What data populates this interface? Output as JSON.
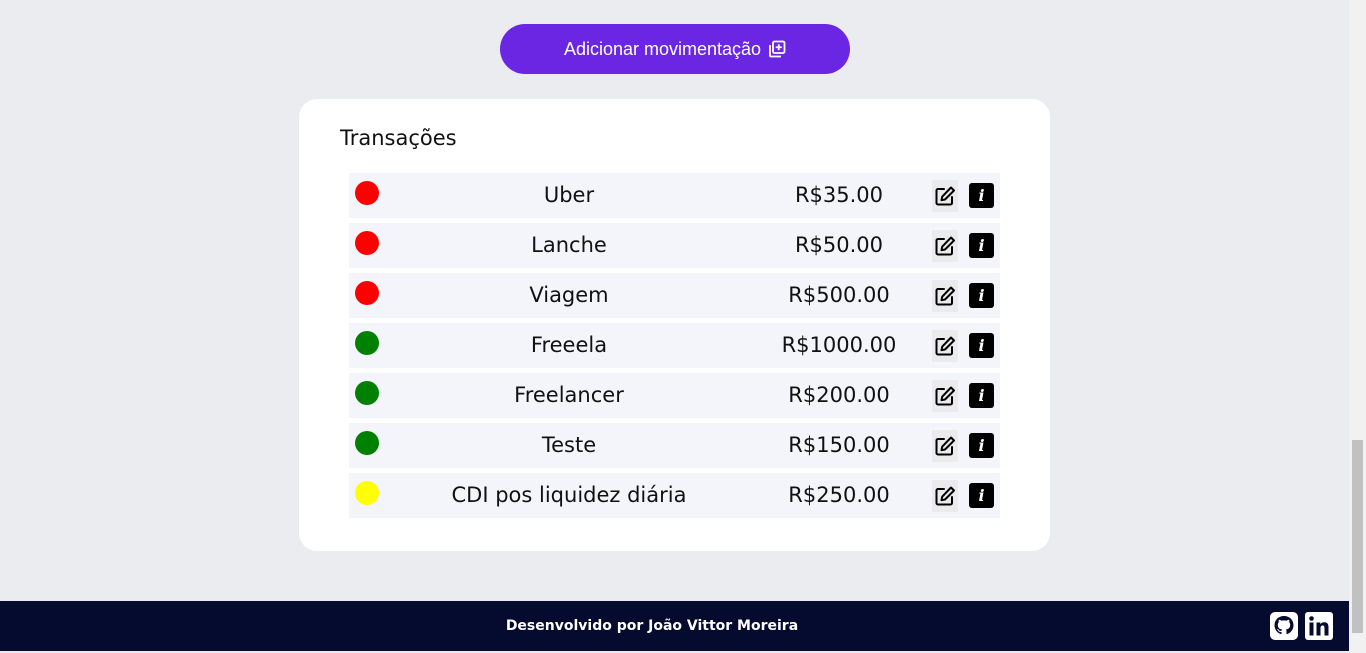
{
  "header": {
    "add_button_label": "Adicionar movimentação",
    "add_button_icon": "add-copy-icon"
  },
  "transactions": {
    "title": "Transações",
    "items": [
      {
        "description": "Uber",
        "amount": "R$35.00",
        "status_color": "#ff0000"
      },
      {
        "description": "Lanche",
        "amount": "R$50.00",
        "status_color": "#ff0000"
      },
      {
        "description": "Viagem",
        "amount": "R$500.00",
        "status_color": "#ff0000"
      },
      {
        "description": "Freeela",
        "amount": "R$1000.00",
        "status_color": "#008000"
      },
      {
        "description": "Freelancer",
        "amount": "R$200.00",
        "status_color": "#008000"
      },
      {
        "description": "Teste",
        "amount": "R$150.00",
        "status_color": "#008000"
      },
      {
        "description": "CDI pos liquidez diária",
        "amount": "R$250.00",
        "status_color": "#ffff00"
      }
    ],
    "edit_icon": "edit-icon",
    "info_icon": "info-icon",
    "info_glyph": "i"
  },
  "footer": {
    "credit": "Desenvolvido por João Vittor Moreira",
    "links": [
      {
        "icon": "github-icon"
      },
      {
        "icon": "linkedin-icon"
      }
    ]
  },
  "colors": {
    "accent": "#6a26e3",
    "background": "#ebecf0",
    "footer": "#050a2f",
    "row": "#f4f5fa"
  }
}
